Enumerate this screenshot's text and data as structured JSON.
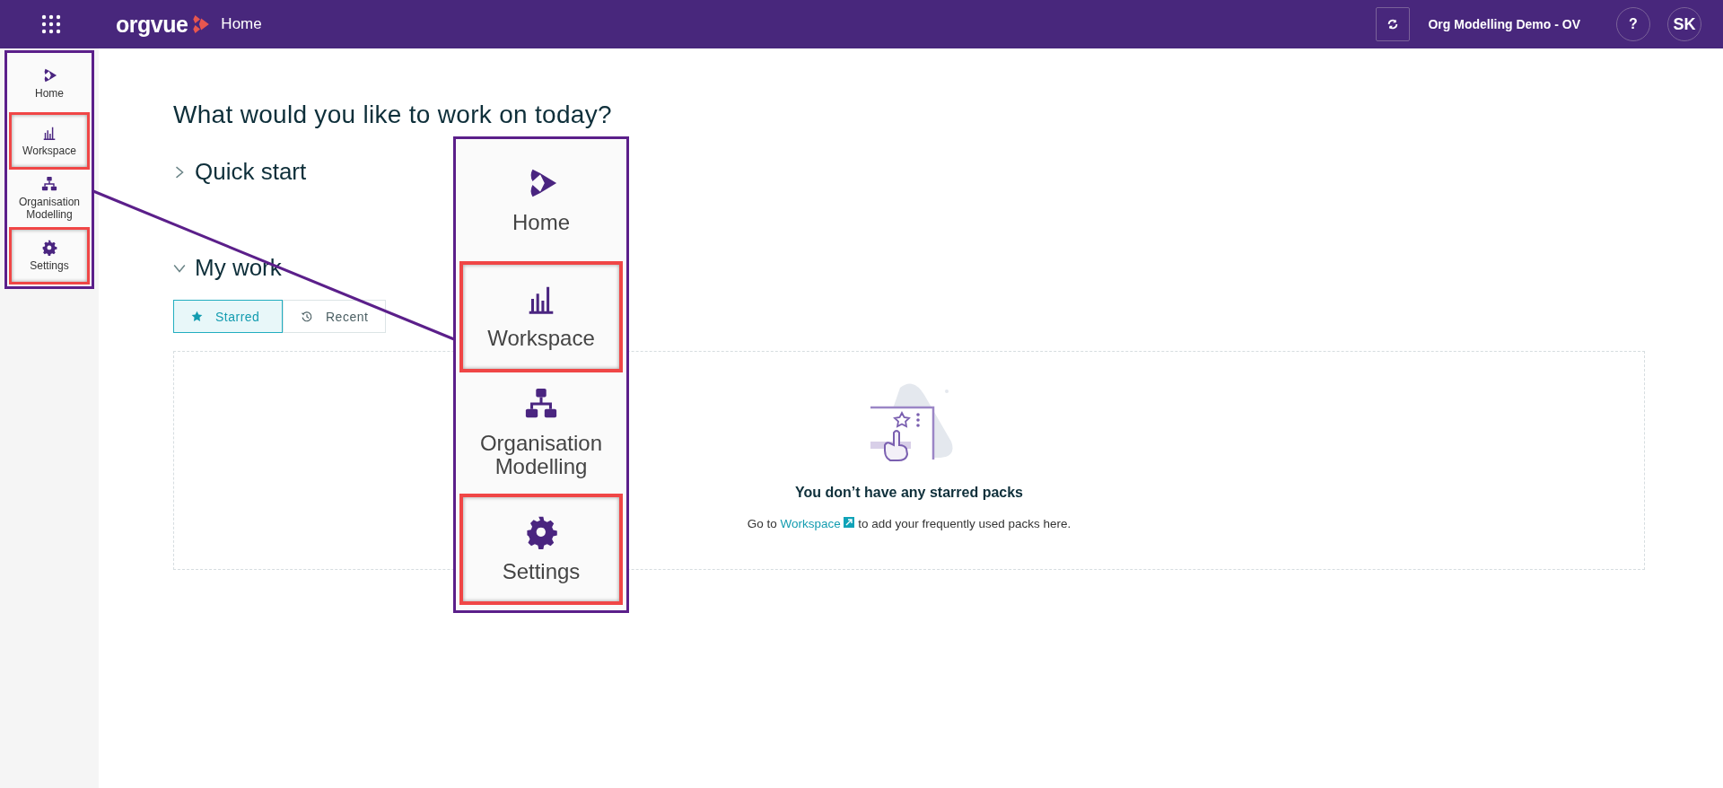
{
  "top_bar": {
    "logo": "orgvue",
    "page_title": "Home",
    "workspace_name": "Org Modelling Demo - OV",
    "help": "?",
    "avatar": "SK"
  },
  "sidebar": {
    "items": [
      {
        "kind": "home",
        "label": "Home",
        "highlighted": false
      },
      {
        "kind": "workspace",
        "label": "Workspace",
        "highlighted": true
      },
      {
        "kind": "org",
        "label": "Organisation Modelling",
        "highlighted": false
      },
      {
        "kind": "settings",
        "label": "Settings",
        "highlighted": true
      }
    ]
  },
  "main": {
    "heading": "What would you like to work on today?",
    "sections": [
      {
        "title": "Quick start",
        "expanded": false
      },
      {
        "title": "My work",
        "expanded": true
      }
    ],
    "tabs": [
      {
        "kind": "star",
        "label": "Starred",
        "selected": true
      },
      {
        "kind": "history",
        "label": "Recent",
        "selected": false
      }
    ],
    "empty_state": {
      "title": "You don’t have any starred packs",
      "before": "Go to",
      "link": "Workspace",
      "after": "to add your frequently used packs here."
    }
  },
  "callout": {
    "items": [
      {
        "kind": "home",
        "label": "Home",
        "highlighted": false
      },
      {
        "kind": "workspace",
        "label": "Workspace",
        "highlighted": true
      },
      {
        "kind": "org",
        "label": "Organisation Modelling",
        "highlighted": false
      },
      {
        "kind": "settings",
        "label": "Settings",
        "highlighted": true
      }
    ]
  }
}
